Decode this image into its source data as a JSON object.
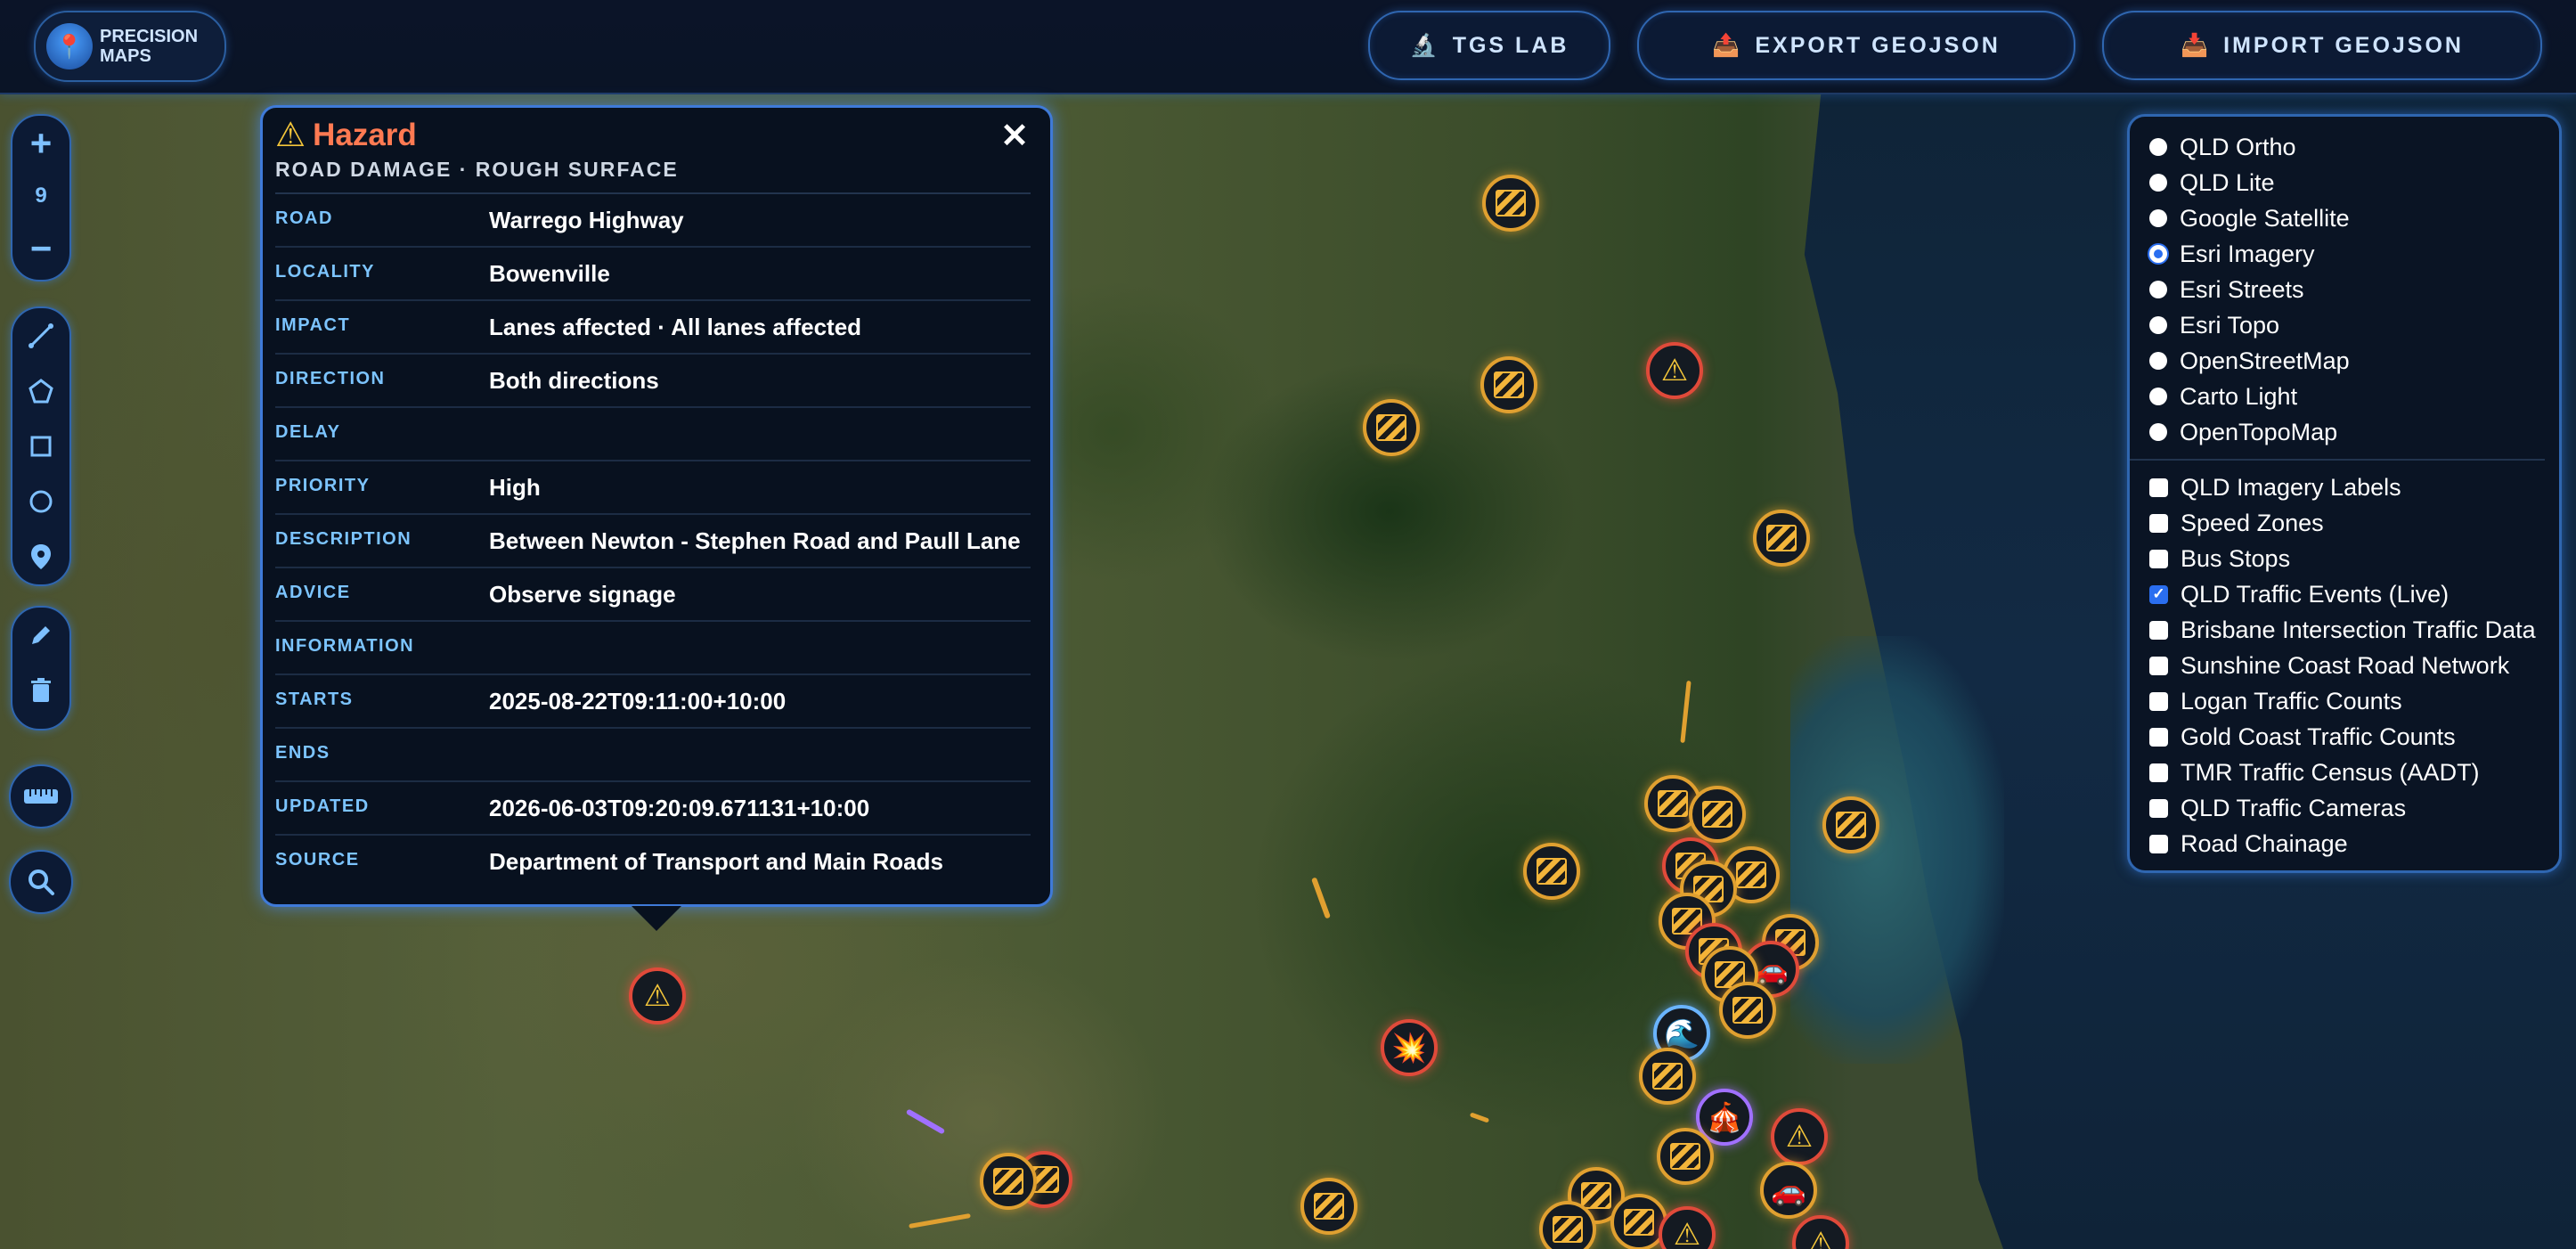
{
  "app": {
    "logo_line1": "PRECISION",
    "logo_line2": "MAPS"
  },
  "toolbar": {
    "tgs_lab": "TGS LAB",
    "export": "EXPORT GEOJSON",
    "import": "IMPORT GEOJSON"
  },
  "zoom": {
    "in": "+",
    "level": "9",
    "out": "−"
  },
  "popup": {
    "title": "Hazard",
    "subtitle": "ROAD DAMAGE · ROUGH SURFACE",
    "close": "✕",
    "rows": [
      {
        "label": "ROAD",
        "value": "Warrego Highway"
      },
      {
        "label": "LOCALITY",
        "value": "Bowenville"
      },
      {
        "label": "IMPACT",
        "value": "Lanes affected · All lanes affected"
      },
      {
        "label": "DIRECTION",
        "value": "Both directions"
      },
      {
        "label": "DELAY",
        "value": ""
      },
      {
        "label": "PRIORITY",
        "value": "High"
      },
      {
        "label": "DESCRIPTION",
        "value": "Between Newton - Stephen Road and Paull Lane"
      },
      {
        "label": "ADVICE",
        "value": "Observe signage"
      },
      {
        "label": "INFORMATION",
        "value": ""
      },
      {
        "label": "STARTS",
        "value": "2025-08-22T09:11:00+10:00"
      },
      {
        "label": "ENDS",
        "value": ""
      },
      {
        "label": "UPDATED",
        "value": "2026-06-03T09:20:09.671131+10:00"
      },
      {
        "label": "SOURCE",
        "value": "Department of Transport and Main Roads"
      }
    ]
  },
  "layers": {
    "basemaps": [
      {
        "label": "QLD Ortho",
        "selected": false
      },
      {
        "label": "QLD Lite",
        "selected": false
      },
      {
        "label": "Google Satellite",
        "selected": false
      },
      {
        "label": "Esri Imagery",
        "selected": true
      },
      {
        "label": "Esri Streets",
        "selected": false
      },
      {
        "label": "Esri Topo",
        "selected": false
      },
      {
        "label": "OpenStreetMap",
        "selected": false
      },
      {
        "label": "Carto Light",
        "selected": false
      },
      {
        "label": "OpenTopoMap",
        "selected": false
      }
    ],
    "overlays": [
      {
        "label": "QLD Imagery Labels",
        "checked": false
      },
      {
        "label": "Speed Zones",
        "checked": false
      },
      {
        "label": "Bus Stops",
        "checked": false
      },
      {
        "label": "QLD Traffic Events (Live)",
        "checked": true
      },
      {
        "label": "Brisbane Intersection Traffic Data",
        "checked": false
      },
      {
        "label": "Sunshine Coast Road Network",
        "checked": false
      },
      {
        "label": "Logan Traffic Counts",
        "checked": false
      },
      {
        "label": "Gold Coast Traffic Counts",
        "checked": false
      },
      {
        "label": "TMR Traffic Census (AADT)",
        "checked": false
      },
      {
        "label": "QLD Traffic Cameras",
        "checked": false
      },
      {
        "label": "Road Chainage",
        "checked": false
      }
    ]
  },
  "colors": {
    "accent": "#2f66b0",
    "hazard_title": "#ff7a52",
    "label": "#7cc4ff"
  }
}
